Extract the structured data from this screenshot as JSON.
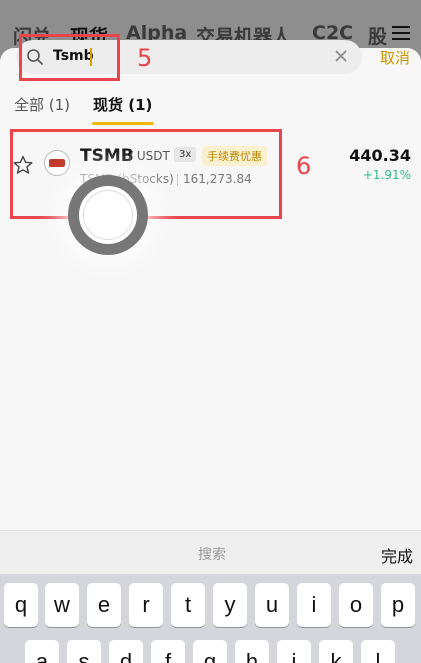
{
  "topnav": {
    "tabs": [
      "闪兑",
      "现货",
      "Alpha",
      "交易机器人",
      "C2C",
      "股"
    ]
  },
  "search": {
    "query": "Tsmb",
    "cancel_label": "取消"
  },
  "annotations": {
    "label_5": "5",
    "label_6": "6"
  },
  "filters": [
    {
      "label": "全部 (1)"
    },
    {
      "label": "现货 (1)"
    }
  ],
  "result": {
    "symbol": "TSMB",
    "quote": "/ USDT",
    "leverage": "3x",
    "promo": "手续费优惠",
    "subtitle": "TSMB (bStocks)",
    "volume": "161,273.84",
    "price": "440.34",
    "change": "+1.91%",
    "change_color": "#2ebd85"
  },
  "keyboard": {
    "placeholder": "搜索",
    "done_label": "完成",
    "row1": [
      "q",
      "w",
      "e",
      "r",
      "t",
      "y",
      "u",
      "i",
      "o",
      "p"
    ],
    "row2": [
      "a",
      "s",
      "d",
      "f",
      "g",
      "h",
      "j",
      "k",
      "l"
    ]
  },
  "colors": {
    "accent": "#f0b90b",
    "annotation": "#e8454c"
  }
}
